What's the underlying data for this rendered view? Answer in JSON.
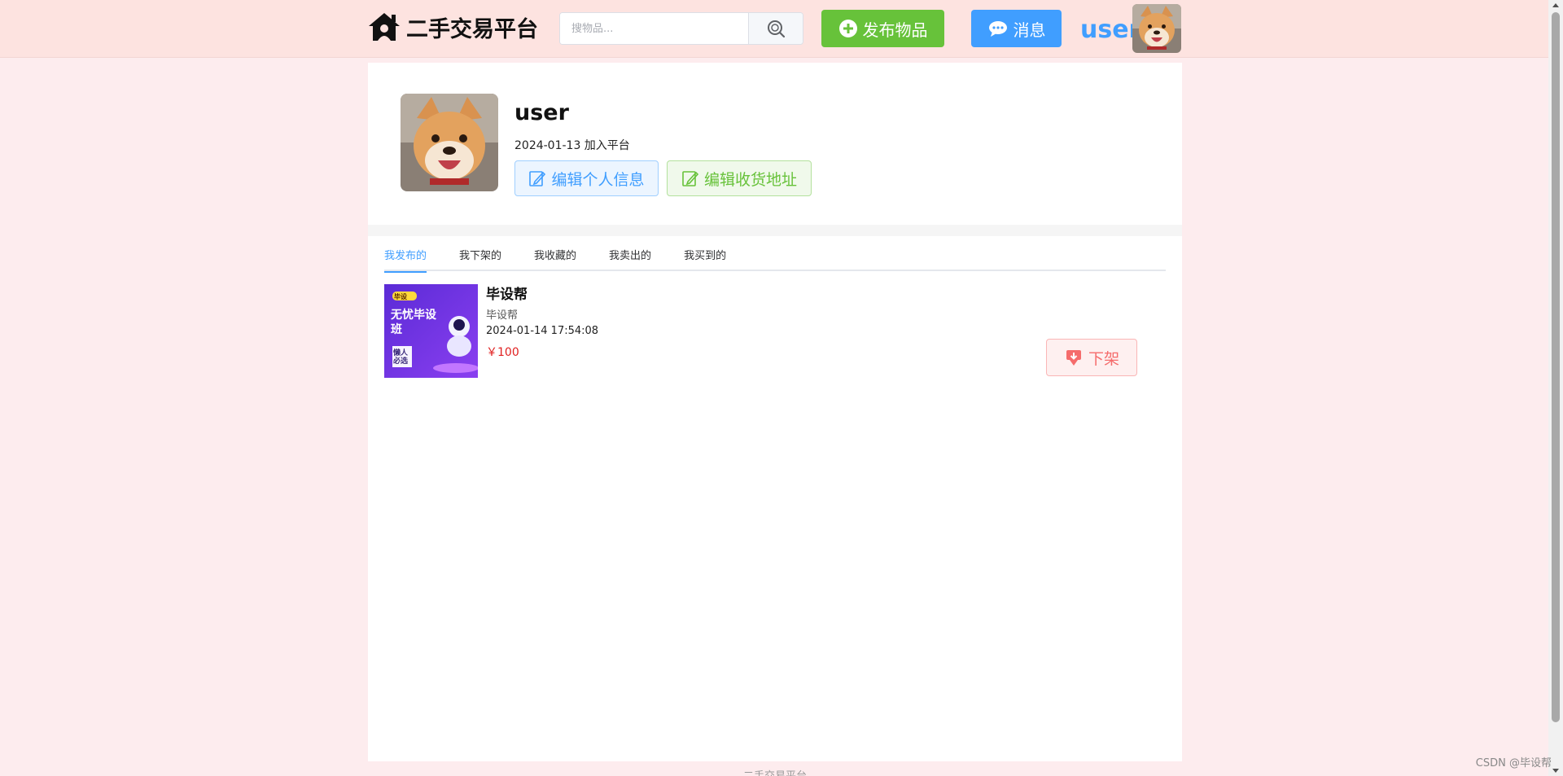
{
  "header": {
    "logo_text": "二手交易平台",
    "search_placeholder": "搜物品...",
    "publish_label": "发布物品",
    "message_label": "消息",
    "username": "user"
  },
  "profile": {
    "username": "user",
    "joined_text": "2024-01-13 加入平台",
    "edit_info_label": "编辑个人信息",
    "edit_address_label": "编辑收货地址"
  },
  "tabs": [
    {
      "label": "我发布的",
      "active": true
    },
    {
      "label": "我下架的",
      "active": false
    },
    {
      "label": "我收藏的",
      "active": false
    },
    {
      "label": "我卖出的",
      "active": false
    },
    {
      "label": "我买到的",
      "active": false
    }
  ],
  "items": [
    {
      "thumb_badge": "毕设",
      "thumb_title": "无忧毕设班",
      "thumb_sub": "懒人必选",
      "title": "毕设帮",
      "desc": "毕设帮",
      "time": "2024-01-14 17:54:08",
      "price": "￥100",
      "action_label": "下架"
    }
  ],
  "footer_text": "二手交易平台",
  "watermark": "CSDN @毕设帮",
  "colors": {
    "primary": "#409eff",
    "success": "#67c23a",
    "danger": "#f56c6c",
    "header_bg": "#fde3e0",
    "page_bg": "#fdecee"
  }
}
